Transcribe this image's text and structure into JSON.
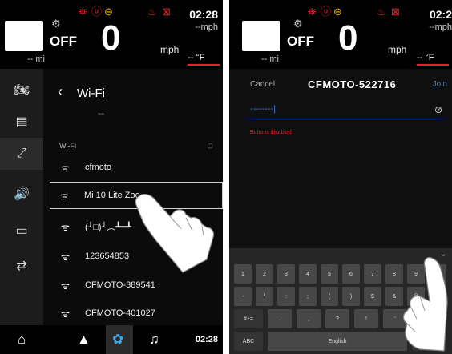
{
  "left_screen": {
    "header": {
      "time": "02:28",
      "speed": "0",
      "speed_unit": "mph",
      "trip_unit": "--mph",
      "mode": "OFF",
      "odometer": "-- mi",
      "temperature": "-- °F"
    },
    "wifi": {
      "title": "Wi-Fi",
      "connected_value": "--",
      "section_label": "Wi-Fi",
      "networks": [
        {
          "name": "cfmoto"
        },
        {
          "name": "Mi 10 Lite Zoo"
        },
        {
          "name": "(╯□)╯︵┻━┻"
        },
        {
          "name": "123654853"
        },
        {
          "name": "CFMOTO-389541"
        },
        {
          "name": "CFMOTO-401027"
        }
      ],
      "selected_index": 1
    },
    "bottom_bar": {
      "time": "02:28"
    }
  },
  "right_screen": {
    "header": {
      "time": "02:2",
      "speed": "0",
      "speed_unit": "mph",
      "trip_unit": "--mph",
      "mode": "OFF",
      "odometer": "-- mi",
      "temperature": "-- °F"
    },
    "dialog": {
      "cancel_label": "Cancel",
      "network_name": "CFMOTO-522716",
      "join_label": "Join",
      "password_value": "--------|",
      "error_text": "Buttons disabled"
    },
    "keyboard": {
      "row1": [
        "1",
        "2",
        "3",
        "4",
        "5",
        "6",
        "7",
        "8",
        "9",
        "0"
      ],
      "row2": [
        "-",
        "/",
        ":",
        ";",
        "(",
        ")",
        "$",
        "&",
        "@",
        "\""
      ],
      "row3": [
        "#+=",
        ".",
        ",",
        "?",
        "!",
        "'",
        "⌫"
      ],
      "row4": [
        "ABC",
        "English",
        "↵"
      ]
    }
  },
  "colors": {
    "accent_red": "#e8202a",
    "warning_yellow": "#f0b400",
    "accent_blue": "#3a7ad8",
    "background": "#101010"
  }
}
